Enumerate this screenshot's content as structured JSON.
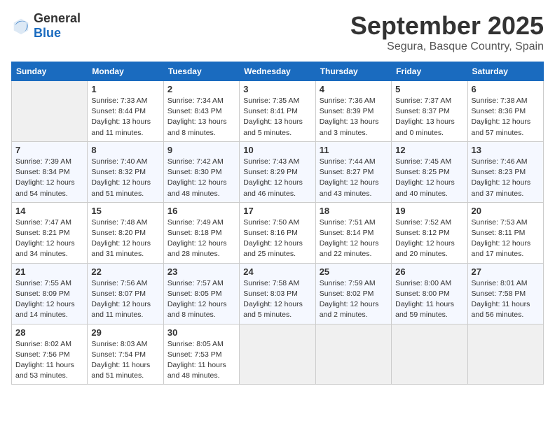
{
  "header": {
    "logo_general": "General",
    "logo_blue": "Blue",
    "month": "September 2025",
    "location": "Segura, Basque Country, Spain"
  },
  "days_of_week": [
    "Sunday",
    "Monday",
    "Tuesday",
    "Wednesday",
    "Thursday",
    "Friday",
    "Saturday"
  ],
  "weeks": [
    [
      {
        "day": "",
        "info": ""
      },
      {
        "day": "1",
        "info": "Sunrise: 7:33 AM\nSunset: 8:44 PM\nDaylight: 13 hours\nand 11 minutes."
      },
      {
        "day": "2",
        "info": "Sunrise: 7:34 AM\nSunset: 8:43 PM\nDaylight: 13 hours\nand 8 minutes."
      },
      {
        "day": "3",
        "info": "Sunrise: 7:35 AM\nSunset: 8:41 PM\nDaylight: 13 hours\nand 5 minutes."
      },
      {
        "day": "4",
        "info": "Sunrise: 7:36 AM\nSunset: 8:39 PM\nDaylight: 13 hours\nand 3 minutes."
      },
      {
        "day": "5",
        "info": "Sunrise: 7:37 AM\nSunset: 8:37 PM\nDaylight: 13 hours\nand 0 minutes."
      },
      {
        "day": "6",
        "info": "Sunrise: 7:38 AM\nSunset: 8:36 PM\nDaylight: 12 hours\nand 57 minutes."
      }
    ],
    [
      {
        "day": "7",
        "info": "Sunrise: 7:39 AM\nSunset: 8:34 PM\nDaylight: 12 hours\nand 54 minutes."
      },
      {
        "day": "8",
        "info": "Sunrise: 7:40 AM\nSunset: 8:32 PM\nDaylight: 12 hours\nand 51 minutes."
      },
      {
        "day": "9",
        "info": "Sunrise: 7:42 AM\nSunset: 8:30 PM\nDaylight: 12 hours\nand 48 minutes."
      },
      {
        "day": "10",
        "info": "Sunrise: 7:43 AM\nSunset: 8:29 PM\nDaylight: 12 hours\nand 46 minutes."
      },
      {
        "day": "11",
        "info": "Sunrise: 7:44 AM\nSunset: 8:27 PM\nDaylight: 12 hours\nand 43 minutes."
      },
      {
        "day": "12",
        "info": "Sunrise: 7:45 AM\nSunset: 8:25 PM\nDaylight: 12 hours\nand 40 minutes."
      },
      {
        "day": "13",
        "info": "Sunrise: 7:46 AM\nSunset: 8:23 PM\nDaylight: 12 hours\nand 37 minutes."
      }
    ],
    [
      {
        "day": "14",
        "info": "Sunrise: 7:47 AM\nSunset: 8:21 PM\nDaylight: 12 hours\nand 34 minutes."
      },
      {
        "day": "15",
        "info": "Sunrise: 7:48 AM\nSunset: 8:20 PM\nDaylight: 12 hours\nand 31 minutes."
      },
      {
        "day": "16",
        "info": "Sunrise: 7:49 AM\nSunset: 8:18 PM\nDaylight: 12 hours\nand 28 minutes."
      },
      {
        "day": "17",
        "info": "Sunrise: 7:50 AM\nSunset: 8:16 PM\nDaylight: 12 hours\nand 25 minutes."
      },
      {
        "day": "18",
        "info": "Sunrise: 7:51 AM\nSunset: 8:14 PM\nDaylight: 12 hours\nand 22 minutes."
      },
      {
        "day": "19",
        "info": "Sunrise: 7:52 AM\nSunset: 8:12 PM\nDaylight: 12 hours\nand 20 minutes."
      },
      {
        "day": "20",
        "info": "Sunrise: 7:53 AM\nSunset: 8:11 PM\nDaylight: 12 hours\nand 17 minutes."
      }
    ],
    [
      {
        "day": "21",
        "info": "Sunrise: 7:55 AM\nSunset: 8:09 PM\nDaylight: 12 hours\nand 14 minutes."
      },
      {
        "day": "22",
        "info": "Sunrise: 7:56 AM\nSunset: 8:07 PM\nDaylight: 12 hours\nand 11 minutes."
      },
      {
        "day": "23",
        "info": "Sunrise: 7:57 AM\nSunset: 8:05 PM\nDaylight: 12 hours\nand 8 minutes."
      },
      {
        "day": "24",
        "info": "Sunrise: 7:58 AM\nSunset: 8:03 PM\nDaylight: 12 hours\nand 5 minutes."
      },
      {
        "day": "25",
        "info": "Sunrise: 7:59 AM\nSunset: 8:02 PM\nDaylight: 12 hours\nand 2 minutes."
      },
      {
        "day": "26",
        "info": "Sunrise: 8:00 AM\nSunset: 8:00 PM\nDaylight: 11 hours\nand 59 minutes."
      },
      {
        "day": "27",
        "info": "Sunrise: 8:01 AM\nSunset: 7:58 PM\nDaylight: 11 hours\nand 56 minutes."
      }
    ],
    [
      {
        "day": "28",
        "info": "Sunrise: 8:02 AM\nSunset: 7:56 PM\nDaylight: 11 hours\nand 53 minutes."
      },
      {
        "day": "29",
        "info": "Sunrise: 8:03 AM\nSunset: 7:54 PM\nDaylight: 11 hours\nand 51 minutes."
      },
      {
        "day": "30",
        "info": "Sunrise: 8:05 AM\nSunset: 7:53 PM\nDaylight: 11 hours\nand 48 minutes."
      },
      {
        "day": "",
        "info": ""
      },
      {
        "day": "",
        "info": ""
      },
      {
        "day": "",
        "info": ""
      },
      {
        "day": "",
        "info": ""
      }
    ]
  ]
}
